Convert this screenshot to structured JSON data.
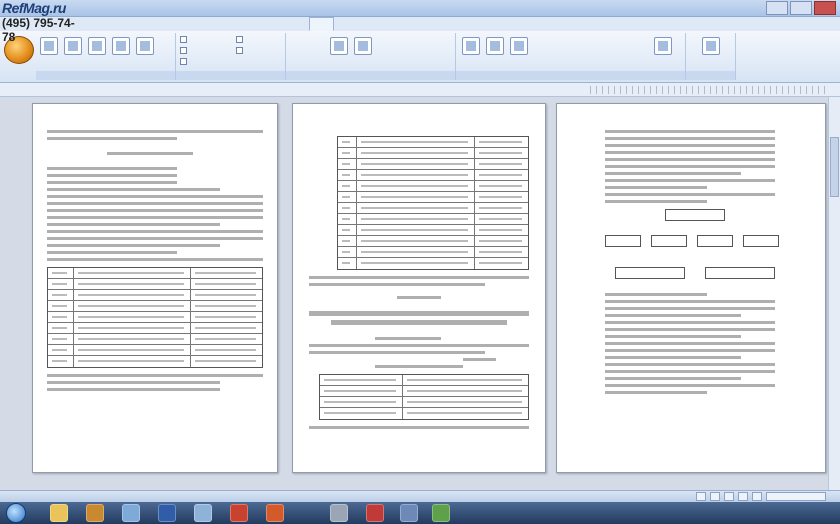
{
  "watermark": {
    "site": "RefMag.ru",
    "phone": "(495) 795-74-78"
  },
  "colors": {
    "ribbon_bg": "#dbe6f4",
    "taskbar": "#2f4a73",
    "office_button": "#e39a2a"
  },
  "icons": [
    "office-button-icon",
    "windows-start-icon",
    "save-icon",
    "undo-icon",
    "redo-icon",
    "scrollbar-thumb",
    "zoom-slider-icon"
  ]
}
